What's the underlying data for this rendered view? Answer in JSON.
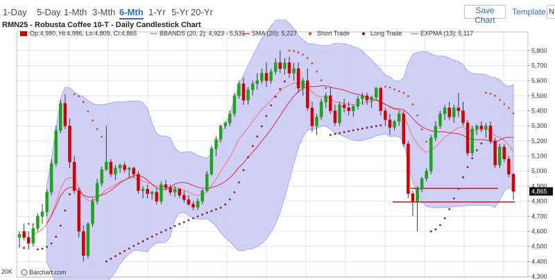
{
  "toolbar": {
    "periods": [
      {
        "label": "1-Day",
        "active": false
      },
      {
        "label": "5-Day",
        "active": false
      },
      {
        "label": "1-Mth",
        "active": false
      },
      {
        "label": "3-Mth",
        "active": false
      },
      {
        "label": "6-Mth",
        "active": true
      },
      {
        "label": "1-Yr",
        "active": false
      },
      {
        "label": "5-Yr",
        "active": false
      },
      {
        "label": "20-Yr",
        "active": false
      }
    ],
    "save_label": "Save Chart",
    "template_label": "Template:",
    "template_value": "N"
  },
  "chart_data": {
    "type": "candlestick",
    "title": "RMN25 - Robusta Coffee 10-T - Daily Candlestick Chart",
    "ylim": [
      4300,
      5850
    ],
    "yticks": [
      4300,
      4400,
      4500,
      4600,
      4700,
      4800,
      4900,
      5000,
      5100,
      5200,
      5300,
      5400,
      5500,
      5600,
      5700,
      5800
    ],
    "ytick_labels": [
      "4,300",
      "4,400",
      "4,500",
      "4,600",
      "4,700",
      "4,800",
      "4,900",
      "5,000",
      "5,100",
      "5,200",
      "5,300",
      "5,400",
      "5,500",
      "5,600",
      "5,700",
      "5,800"
    ],
    "last_price": 4865,
    "last_price_label": "4,865",
    "bottom_left_label": "20K",
    "logo_text": "Barchart.com",
    "legend": [
      {
        "text": "Op:4,980, Hi:4,986, Lo:4,809, Cl:4,865",
        "color": "#d40000",
        "kind": "box"
      },
      {
        "text": "BBANDS (20, 2): 4,923 - 5,531",
        "color": "#8a8ae0",
        "kind": "line"
      },
      {
        "text": "SMA (20): 5,227",
        "color": "#d42a3a",
        "kind": "line"
      },
      {
        "text": "Short Trade",
        "color": "#c8501e",
        "kind": "dot"
      },
      {
        "text": "Long Trade",
        "color": "#8b1a1a",
        "kind": "dot"
      },
      {
        "text": "EXPMA (13): 5,117",
        "color": "#e87868",
        "kind": "line"
      }
    ],
    "colors": {
      "up": "#1aa51a",
      "down": "#d40000",
      "band_fill": "#c8c8f4",
      "band_line": "#9a9ae6",
      "sma": "#d42a3a",
      "expma": "#e87868",
      "short_dots": "#c8501e",
      "long_dots": "#8b1a1a",
      "hlines": "#e00000",
      "grid": "#e3e3e3",
      "last_price_bg": "#111111"
    },
    "hlines": [
      4885,
      4795
    ],
    "ohlc": [
      [
        4560,
        4600,
        4490,
        4580
      ],
      [
        4600,
        4650,
        4540,
        4560
      ],
      [
        4560,
        4600,
        4480,
        4520
      ],
      [
        4520,
        4640,
        4500,
        4620
      ],
      [
        4620,
        4720,
        4600,
        4700
      ],
      [
        4700,
        4780,
        4650,
        4730
      ],
      [
        4730,
        4880,
        4700,
        4860
      ],
      [
        4860,
        5080,
        4840,
        5050
      ],
      [
        5050,
        5300,
        5030,
        5270
      ],
      [
        5270,
        5470,
        5250,
        5450
      ],
      [
        5450,
        5510,
        5280,
        5300
      ],
      [
        5300,
        5350,
        5020,
        5060
      ],
      [
        5060,
        5100,
        4850,
        4870
      ],
      [
        4870,
        4890,
        4560,
        4600
      ],
      [
        4600,
        4640,
        4400,
        4440
      ],
      [
        4440,
        4660,
        4420,
        4650
      ],
      [
        4650,
        4820,
        4630,
        4800
      ],
      [
        4800,
        4950,
        4780,
        4920
      ],
      [
        4920,
        5030,
        4900,
        5010
      ],
      [
        5010,
        5300,
        5000,
        5060
      ],
      [
        5060,
        5080,
        4960,
        4980
      ],
      [
        4980,
        5040,
        4940,
        5020
      ],
      [
        5020,
        5050,
        4990,
        5040
      ],
      [
        5040,
        5060,
        4990,
        5010
      ],
      [
        5010,
        5030,
        4960,
        5020
      ],
      [
        5020,
        5030,
        4960,
        4980
      ],
      [
        4980,
        5000,
        4850,
        4870
      ],
      [
        4870,
        4900,
        4820,
        4880
      ],
      [
        4880,
        4910,
        4820,
        4850
      ],
      [
        4850,
        4870,
        4810,
        4860
      ],
      [
        4860,
        4880,
        4780,
        4800
      ],
      [
        4800,
        4930,
        4780,
        4910
      ],
      [
        4910,
        4940,
        4870,
        4890
      ],
      [
        4890,
        4910,
        4840,
        4860
      ],
      [
        4860,
        4900,
        4830,
        4880
      ],
      [
        4880,
        4890,
        4820,
        4840
      ],
      [
        4840,
        4870,
        4790,
        4810
      ],
      [
        4810,
        4840,
        4770,
        4780
      ],
      [
        4780,
        4800,
        4740,
        4760
      ],
      [
        4760,
        4820,
        4740,
        4800
      ],
      [
        4800,
        4880,
        4780,
        4870
      ],
      [
        4870,
        5000,
        4860,
        4980
      ],
      [
        4980,
        5170,
        4970,
        5150
      ],
      [
        5150,
        5230,
        5100,
        5210
      ],
      [
        5210,
        5310,
        5190,
        5300
      ],
      [
        5300,
        5330,
        5280,
        5320
      ],
      [
        5320,
        5400,
        5300,
        5380
      ],
      [
        5380,
        5520,
        5360,
        5500
      ],
      [
        5500,
        5600,
        5480,
        5580
      ],
      [
        5580,
        5620,
        5440,
        5470
      ],
      [
        5470,
        5560,
        5440,
        5540
      ],
      [
        5540,
        5600,
        5500,
        5580
      ],
      [
        5580,
        5650,
        5540,
        5600
      ],
      [
        5600,
        5680,
        5580,
        5650
      ],
      [
        5650,
        5720,
        5560,
        5600
      ],
      [
        5600,
        5680,
        5580,
        5660
      ],
      [
        5660,
        5750,
        5640,
        5720
      ],
      [
        5720,
        5800,
        5650,
        5680
      ],
      [
        5680,
        5750,
        5640,
        5720
      ],
      [
        5720,
        5760,
        5620,
        5650
      ],
      [
        5650,
        5720,
        5600,
        5680
      ],
      [
        5680,
        5720,
        5520,
        5550
      ],
      [
        5550,
        5620,
        5500,
        5600
      ],
      [
        5600,
        5680,
        5400,
        5420
      ],
      [
        5420,
        5460,
        5260,
        5300
      ],
      [
        5300,
        5380,
        5240,
        5360
      ],
      [
        5360,
        5480,
        5340,
        5460
      ],
      [
        5460,
        5520,
        5420,
        5500
      ],
      [
        5500,
        5560,
        5380,
        5400
      ],
      [
        5400,
        5440,
        5300,
        5320
      ],
      [
        5320,
        5460,
        5300,
        5440
      ],
      [
        5440,
        5480,
        5390,
        5420
      ],
      [
        5420,
        5460,
        5370,
        5400
      ],
      [
        5400,
        5440,
        5360,
        5430
      ],
      [
        5430,
        5500,
        5410,
        5480
      ],
      [
        5480,
        5520,
        5440,
        5500
      ],
      [
        5500,
        5520,
        5440,
        5470
      ],
      [
        5470,
        5500,
        5420,
        5490
      ],
      [
        5490,
        5560,
        5470,
        5550
      ],
      [
        5550,
        5560,
        5370,
        5400
      ],
      [
        5400,
        5420,
        5300,
        5340
      ],
      [
        5340,
        5380,
        5240,
        5290
      ],
      [
        5290,
        5340,
        5270,
        5330
      ],
      [
        5330,
        5400,
        5300,
        5380
      ],
      [
        5380,
        5400,
        5160,
        5180
      ],
      [
        5180,
        5200,
        4820,
        4850
      ],
      [
        4850,
        4870,
        4700,
        4800
      ],
      [
        4800,
        4900,
        4600,
        4880
      ],
      [
        4880,
        4960,
        4860,
        4950
      ],
      [
        4950,
        5020,
        4930,
        5000
      ],
      [
        5000,
        5240,
        4980,
        5220
      ],
      [
        5220,
        5330,
        5200,
        5300
      ],
      [
        5300,
        5400,
        5280,
        5380
      ],
      [
        5380,
        5440,
        5340,
        5420
      ],
      [
        5420,
        5460,
        5340,
        5360
      ],
      [
        5360,
        5440,
        5320,
        5420
      ],
      [
        5420,
        5520,
        5360,
        5400
      ],
      [
        5400,
        5460,
        5300,
        5320
      ],
      [
        5320,
        5340,
        5100,
        5120
      ],
      [
        5120,
        5300,
        5100,
        5280
      ],
      [
        5280,
        5310,
        5240,
        5300
      ],
      [
        5300,
        5330,
        5260,
        5280
      ],
      [
        5280,
        5320,
        5220,
        5300
      ],
      [
        5300,
        5330,
        5180,
        5200
      ],
      [
        5200,
        5220,
        5020,
        5040
      ],
      [
        5040,
        5180,
        5020,
        5160
      ],
      [
        5160,
        5180,
        5060,
        5080
      ],
      [
        5080,
        5100,
        4960,
        4980
      ],
      [
        4980,
        4986,
        4809,
        4865
      ]
    ]
  }
}
